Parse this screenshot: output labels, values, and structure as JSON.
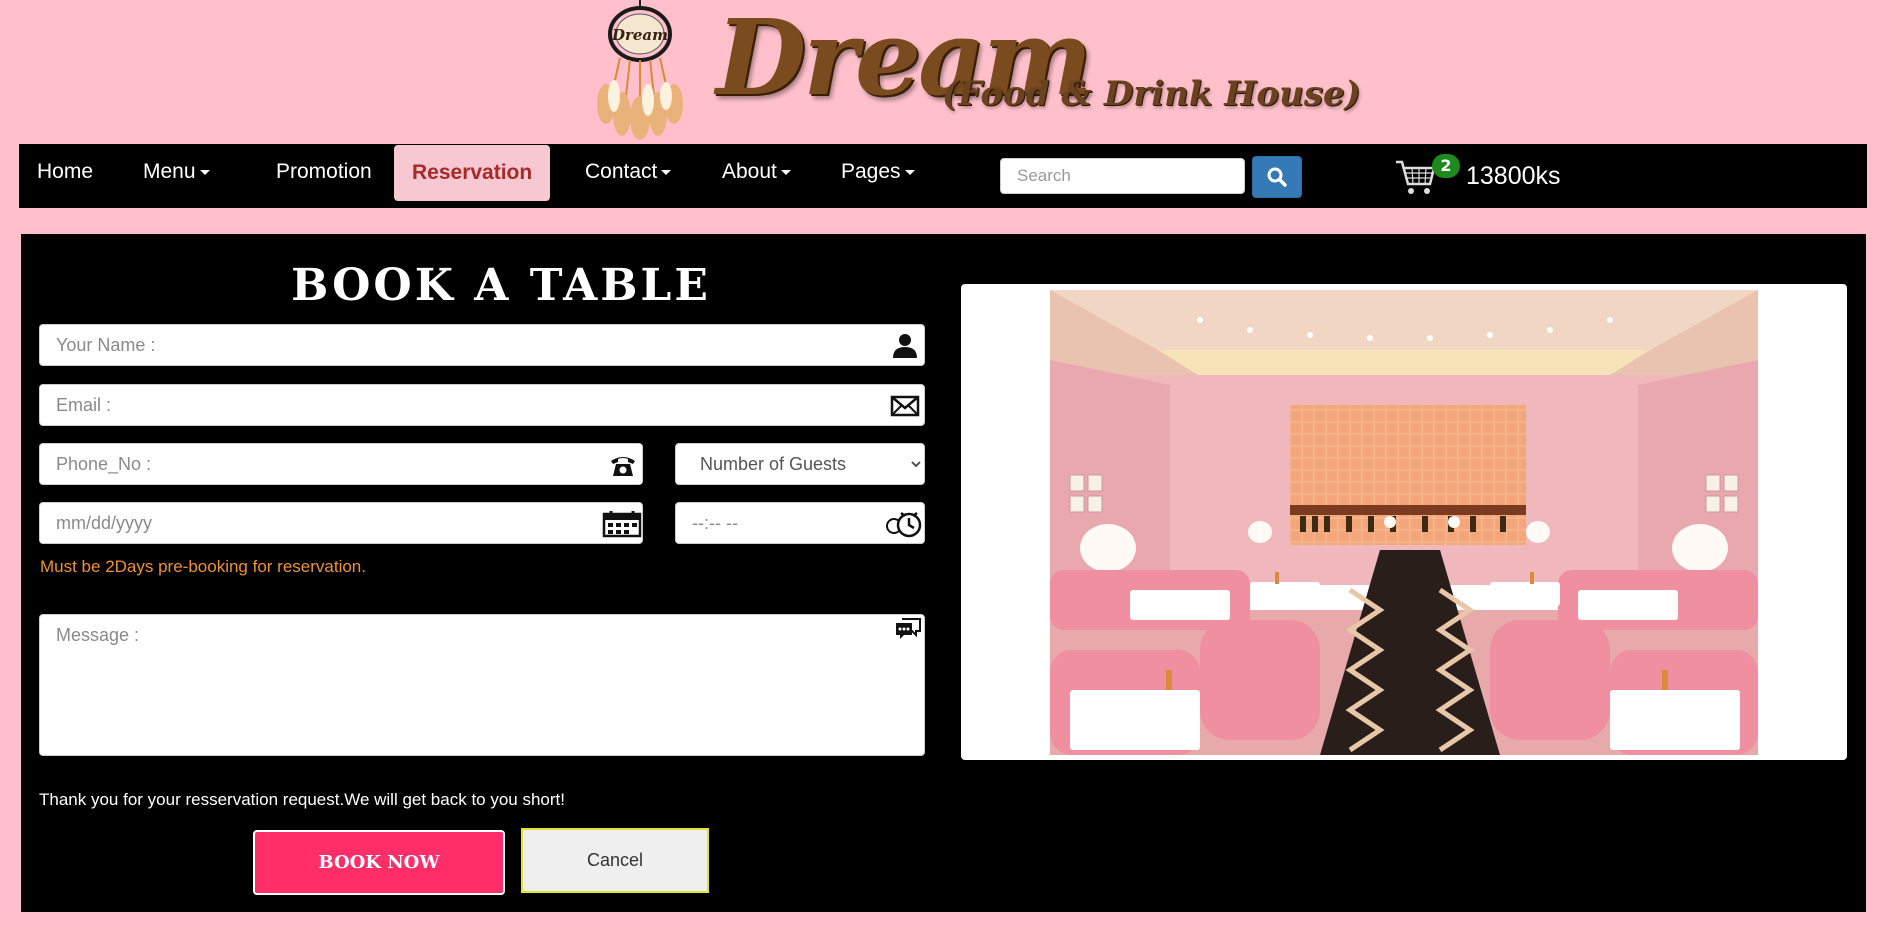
{
  "brand": {
    "logo_badge": "Dream",
    "name": "Dream",
    "tagline": "(Food & Drink House)"
  },
  "nav": {
    "items": [
      {
        "label": "Home",
        "dropdown": false,
        "active": false
      },
      {
        "label": "Menu",
        "dropdown": true,
        "active": false
      },
      {
        "label": "Promotion",
        "dropdown": false,
        "active": false
      },
      {
        "label": "Reservation",
        "dropdown": false,
        "active": true
      },
      {
        "label": "Contact",
        "dropdown": true,
        "active": false
      },
      {
        "label": "About",
        "dropdown": true,
        "active": false
      },
      {
        "label": "Pages",
        "dropdown": true,
        "active": false
      }
    ],
    "search_placeholder": "Search",
    "search_icon": "search-icon",
    "cart": {
      "icon": "cart-icon",
      "count": "2",
      "total": "13800ks"
    }
  },
  "form": {
    "title": "BOOK A TABLE",
    "name_placeholder": "Your Name :",
    "email_placeholder": "Email :",
    "phone_placeholder": "Phone_No :",
    "guests_label": "Number of Guests",
    "date_placeholder": "mm/dd/yyyy",
    "time_placeholder": "--:-- --",
    "note": "Must be 2Days pre-booking for reservation.",
    "message_placeholder": "Message :",
    "thanks": "Thank you for your resservation request.We will get back to you short!",
    "book_label": "BOOK NOW",
    "cancel_label": "Cancel"
  },
  "colors": {
    "page_bg": "#ffc0cb",
    "panel_bg": "#000000",
    "active_nav_text": "#a52a2a",
    "note": "#f0922e",
    "book_button": "#ff2e68",
    "search_button": "#337ab7",
    "cart_badge": "#1e8a1e"
  }
}
